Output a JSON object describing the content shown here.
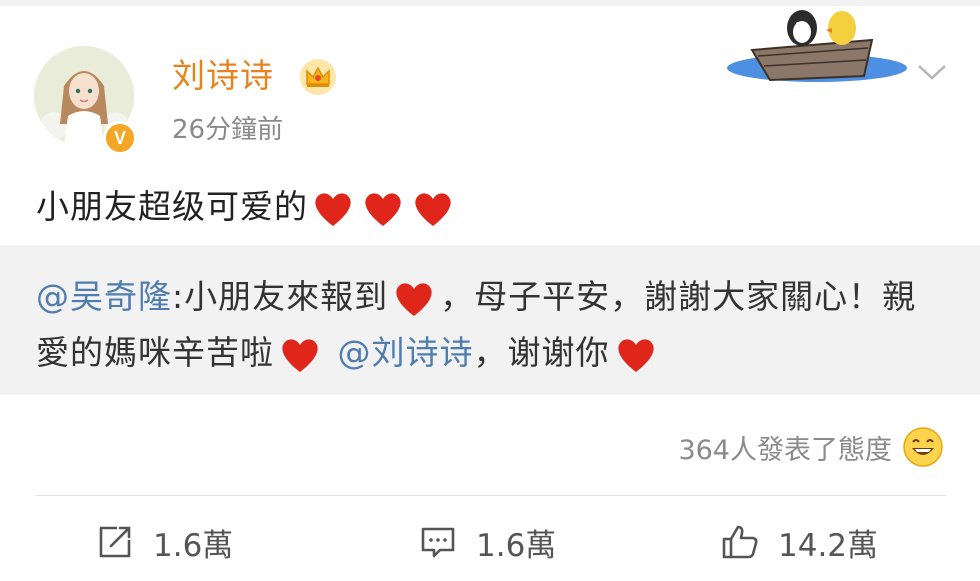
{
  "author": {
    "name": "刘诗诗",
    "time": "26分鐘前",
    "verified_badge": "V"
  },
  "post": {
    "text": "小朋友超级可爱的",
    "hearts": 3
  },
  "quoted": {
    "mention1": "@吴奇隆",
    "text1": ":小朋友來報到",
    "text2": "，母子平安，謝謝大家關心！親愛的媽咪辛苦啦",
    "mention2": "@刘诗诗",
    "text3": "，谢谢你"
  },
  "reactions": {
    "text": "364人發表了態度"
  },
  "actions": {
    "repost": "1.6萬",
    "comment": "1.6萬",
    "like": "14.2萬"
  },
  "colors": {
    "name": "#e8821d",
    "mention": "#507daf",
    "heart": "#e0251b",
    "badge": "#f5a623"
  },
  "icons": [
    "crown-icon",
    "boat-decoration",
    "chevron-down-icon",
    "heart-icon",
    "smile-emoji-icon",
    "repost-icon",
    "comment-icon",
    "like-icon"
  ]
}
